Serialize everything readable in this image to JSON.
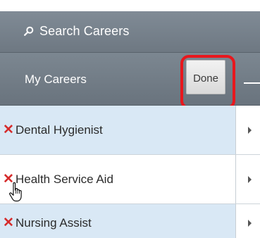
{
  "search": {
    "label": "Search Careers",
    "icon": "search-icon"
  },
  "header": {
    "title": "My Careers",
    "done_label": "Done"
  },
  "careers": [
    {
      "label": "Dental Hygienist",
      "delete_icon": "✕"
    },
    {
      "label": "Health Service Aid",
      "delete_icon": "✕"
    },
    {
      "label": "Nursing Assist",
      "delete_icon": "✕"
    }
  ],
  "colors": {
    "highlight": "#e8171d",
    "delete": "#d52b2b",
    "row_selected": "#d9e8f5",
    "header": "#747f89"
  }
}
